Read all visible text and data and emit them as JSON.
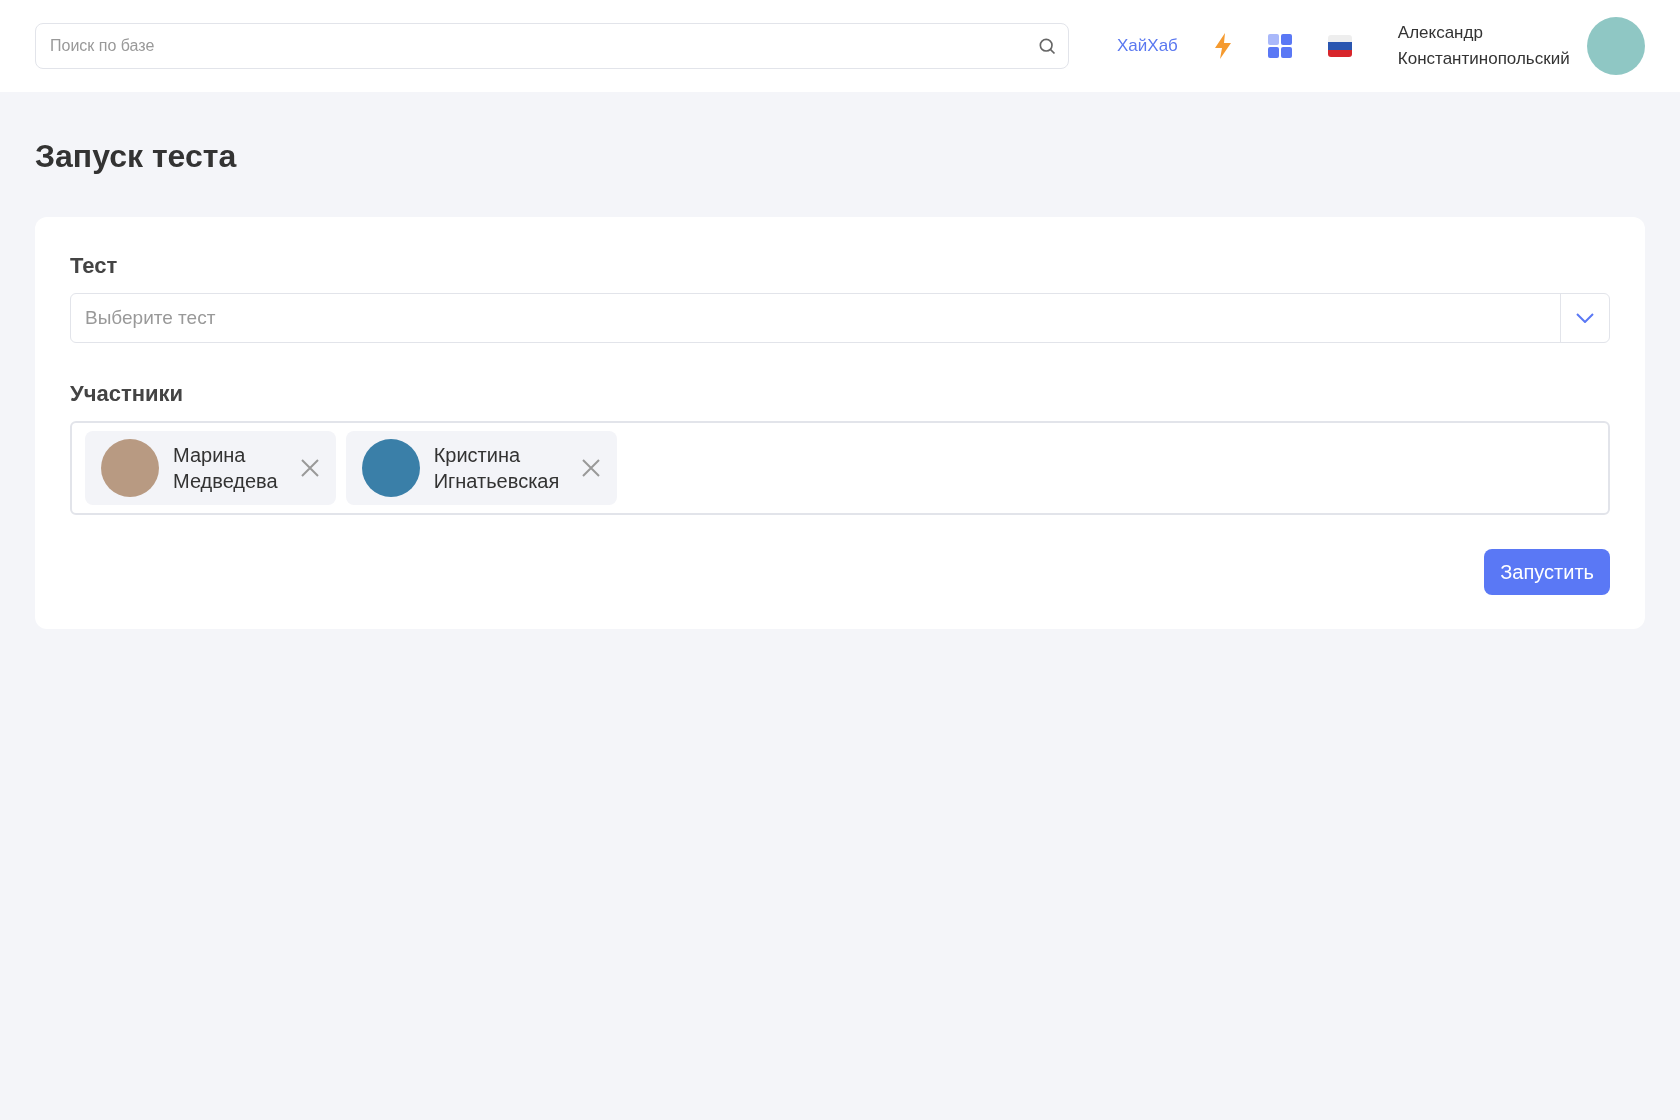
{
  "header": {
    "search": {
      "placeholder": "Поиск по базе"
    },
    "link": "ХайХаб",
    "user_name": "Александр Константинопольский"
  },
  "page_title": "Запуск теста",
  "form": {
    "test_label": "Тест",
    "test_select": {
      "placeholder": "Выберите тест"
    },
    "participants_label": "Участники",
    "participants": [
      {
        "name": "Марина Медведева"
      },
      {
        "name": "Кристина Игнатьевская"
      }
    ],
    "submit": "Запустить"
  }
}
